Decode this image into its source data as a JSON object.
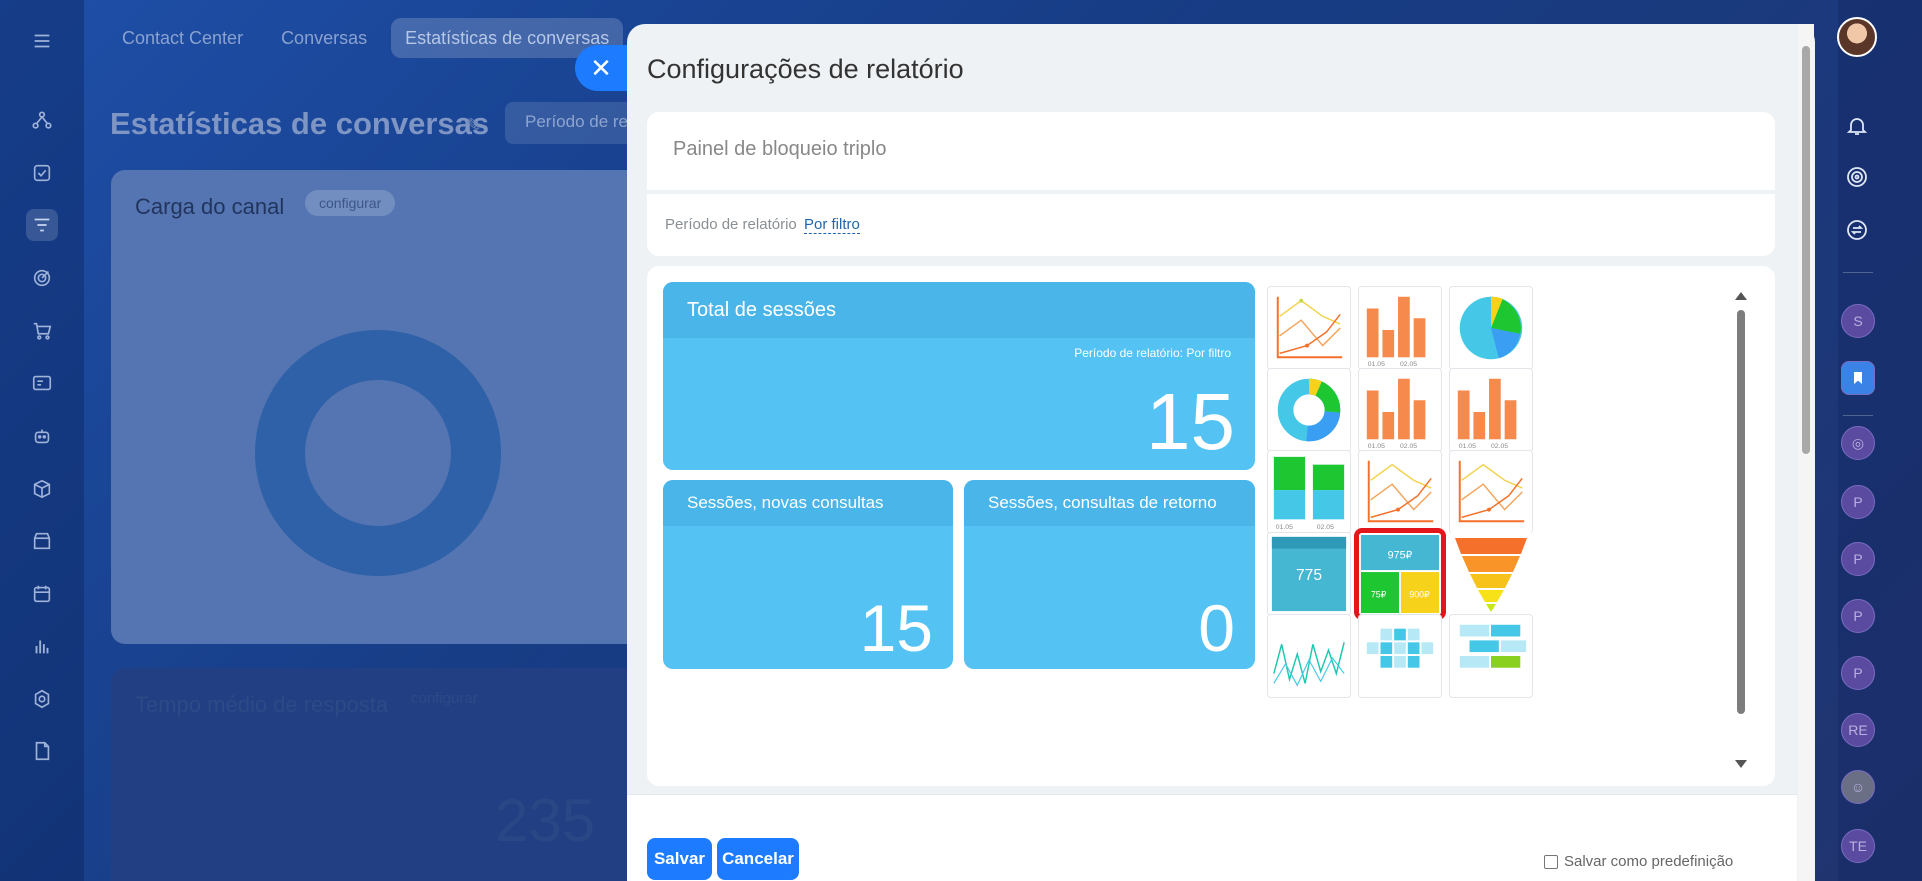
{
  "app": {
    "top_tabs": [
      "Contact Center",
      "Conversas",
      "Estatísticas de conversas"
    ],
    "page_title": "Estatísticas de conversas",
    "period_button": "Período de re",
    "card1": {
      "title": "Carga do canal",
      "configure": "configurar"
    },
    "card2": {
      "title": "Tempo médio de resposta",
      "configure": "configurar",
      "value": "235"
    },
    "right_rail": [
      "S",
      "P",
      "P",
      "P",
      "P",
      "RE",
      "TE"
    ]
  },
  "panel": {
    "title": "Configurações de relatório",
    "name_value": "Painel de bloqueio triplo",
    "period_label": "Período de relatório",
    "period_link": "Por filtro",
    "preview": {
      "main_tile": {
        "title": "Total de sessões",
        "subtitle": "Período de relatório: Por filtro",
        "value": "15"
      },
      "tile_new": {
        "title": "Sessões, novas consultas",
        "value": "15"
      },
      "tile_return": {
        "title": "Sessões, consultas de retorno",
        "value": "0"
      }
    },
    "thumbs": [
      "line-chart",
      "bar-chart",
      "pie-chart",
      "donut-chart",
      "bar-chart",
      "bar-chart",
      "stacked-bar-chart",
      "line-chart",
      "line-chart",
      "number-block",
      "triple-block",
      "funnel-chart",
      "trend-chart",
      "grid-heatmap",
      "horizontal-blocks"
    ],
    "thumb_texts": {
      "number_block_value": "775",
      "triple_top": "975₽",
      "triple_left": "75₽",
      "triple_right": "900₽"
    },
    "thumb_axis": [
      "01.05",
      "02.05"
    ],
    "selected_thumb": "triple-block",
    "buttons": {
      "save": "Salvar",
      "cancel": "Cancelar"
    },
    "save_default_label": "Salvar como predefinição"
  },
  "colors": {
    "accent": "#1d7bff",
    "tile": "#54c3f4",
    "tile_header": "#49b5e8",
    "selection": "#e3161b"
  }
}
